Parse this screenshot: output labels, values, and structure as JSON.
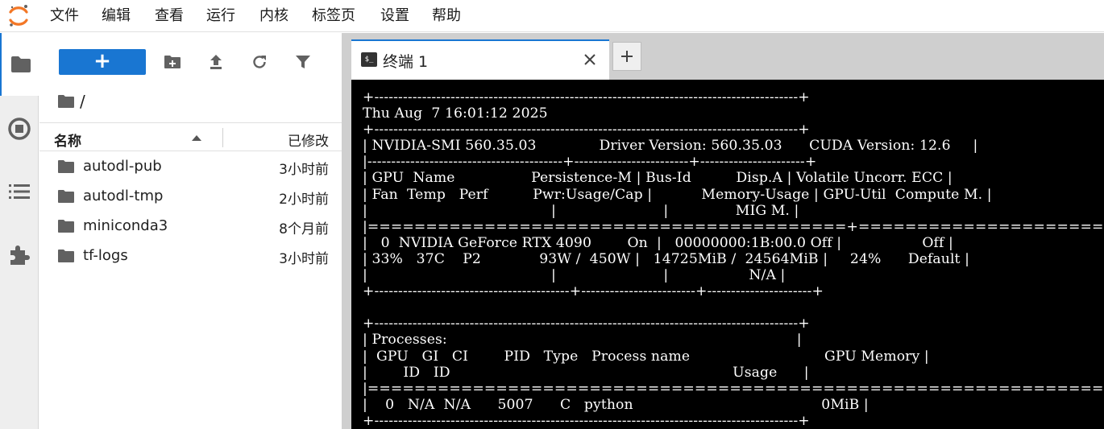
{
  "menu": {
    "items": [
      "文件",
      "编辑",
      "查看",
      "运行",
      "内核",
      "标签页",
      "设置",
      "帮助"
    ]
  },
  "sidebar": {
    "icons": [
      "folder-icon",
      "running-icon",
      "toc-icon",
      "extension-icon"
    ]
  },
  "filebrowser": {
    "new_label": "+",
    "breadcrumb": "/",
    "col_name": "名称",
    "col_modified": "已修改",
    "files": [
      {
        "name": "autodl-pub",
        "modified": "3小时前"
      },
      {
        "name": "autodl-tmp",
        "modified": "2小时前"
      },
      {
        "name": "miniconda3",
        "modified": "8个月前"
      },
      {
        "name": "tf-logs",
        "modified": "3小时前"
      }
    ]
  },
  "tabs": {
    "active_title": "终端 1",
    "icon_text": "$_",
    "add_label": "+"
  },
  "terminal": {
    "output": "+-----------------------------------------------------------------------------------------+\nThu Aug  7 16:01:12 2025\n+-----------------------------------------------------------------------------------------+\n| NVIDIA-SMI 560.35.03              Driver Version: 560.35.03      CUDA Version: 12.6     |\n|-----------------------------------------+------------------------+----------------------+\n| GPU  Name                 Persistence-M | Bus-Id          Disp.A | Volatile Uncorr. ECC |\n| Fan  Temp   Perf          Pwr:Usage/Cap |           Memory-Usage | GPU-Util  Compute M. |\n|                                         |                        |               MIG M. |\n|=========================================+========================+======================|\n|   0  NVIDIA GeForce RTX 4090        On  |   00000000:1B:00.0 Off |                  Off |\n| 33%   37C    P2             93W /  450W |   14725MiB /  24564MiB |     24%      Default |\n|                                         |                        |                  N/A |\n+-----------------------------------------+------------------------+----------------------+\n\n+-----------------------------------------------------------------------------------------+\n| Processes:                                                                              |\n|  GPU   GI   CI        PID   Type   Process name                              GPU Memory |\n|        ID   ID                                                               Usage      |\n|=========================================================================================|\n|    0   N/A  N/A      5007      C   python                                          0MiB |\n+-----------------------------------------------------------------------------------------+"
  },
  "colors": {
    "accent": "#1976d2",
    "terminal_bg": "#000000",
    "terminal_fg": "#ffffff",
    "logo_orange": "#f37726"
  }
}
